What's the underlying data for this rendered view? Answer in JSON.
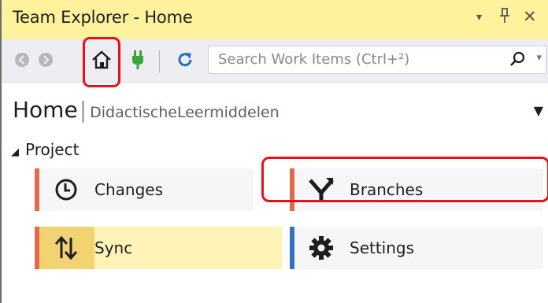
{
  "window": {
    "title": "Team Explorer - Home",
    "dropdown_glyph": "▾",
    "pin_glyph": "ㅍ",
    "close_glyph": "✕"
  },
  "toolbar": {
    "back_icon": "back-arrow-icon",
    "forward_icon": "forward-arrow-icon",
    "home_icon": "home-icon",
    "connect_icon": "plug-icon",
    "refresh_icon": "refresh-icon",
    "search_placeholder": "Search Work Items (Ctrl+²)",
    "search_dropdown": "▾"
  },
  "header": {
    "title": "Home",
    "separator": "|",
    "repo": "DidactischeLeermiddelen",
    "dropdown": "▼"
  },
  "project": {
    "section_label": "Project",
    "collapse_glyph": "◢",
    "tiles": [
      {
        "label": "Changes",
        "icon": "clock-icon",
        "accent": "#e06a4a"
      },
      {
        "label": "Branches",
        "icon": "branch-icon",
        "accent": "#e06a4a"
      },
      {
        "label": "Sync",
        "icon": "sync-arrows-icon",
        "accent": "#e06a4a"
      },
      {
        "label": "Settings",
        "icon": "gear-icon",
        "accent": "#2f72c3"
      }
    ]
  },
  "colors": {
    "titlebar": "#fff29d",
    "toolbar": "#eeeef2",
    "highlight": "#e8101a",
    "git_accent": "#e06a4a",
    "settings_accent": "#2f72c3",
    "sync_tile": "#fff3b8"
  }
}
